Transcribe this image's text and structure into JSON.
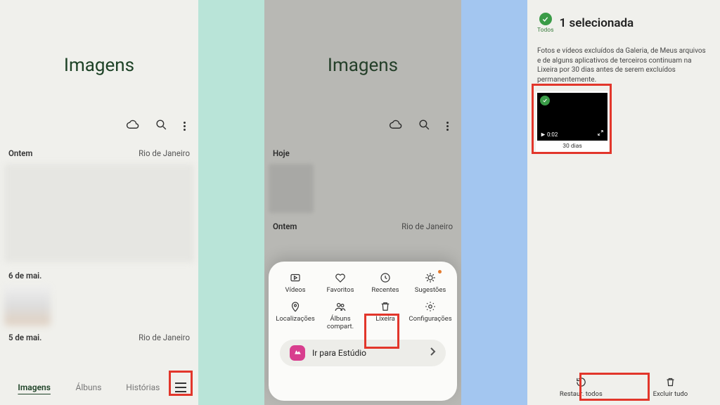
{
  "phone1": {
    "title": "Imagens",
    "sections": [
      {
        "label": "Ontem",
        "loc": "Rio de Janeiro"
      },
      {
        "label": "6 de mai.",
        "loc": ""
      },
      {
        "label": "5 de mai.",
        "loc": "Rio de Janeiro"
      }
    ],
    "tabs": [
      "Imagens",
      "Álbuns",
      "Histórias"
    ]
  },
  "phone2": {
    "title": "Imagens",
    "sections": [
      {
        "label": "Hoje",
        "loc": ""
      },
      {
        "label": "Ontem",
        "loc": "Rio de Janeiro"
      }
    ],
    "menu": {
      "row1": [
        "Vídeos",
        "Favoritos",
        "Recentes",
        "Sugestões"
      ],
      "row2": [
        "Localizações",
        "Álbuns compart.",
        "Lixeira",
        "Configurações"
      ],
      "studio": "Ir para Estúdio"
    }
  },
  "phone3": {
    "all_label": "Todos",
    "selected_title": "1 selecionada",
    "info": "Fotos e vídeos excluídos da Galeria, de Meus arquivos e de alguns aplicativos de terceiros continuam na Lixeira por 30 dias antes de serem excluídos permanentemente.",
    "thumb": {
      "duration": "0:02",
      "remaining": "30 dias"
    },
    "actions": {
      "restore": "Restaur. todos",
      "delete": "Excluir tudo"
    }
  }
}
